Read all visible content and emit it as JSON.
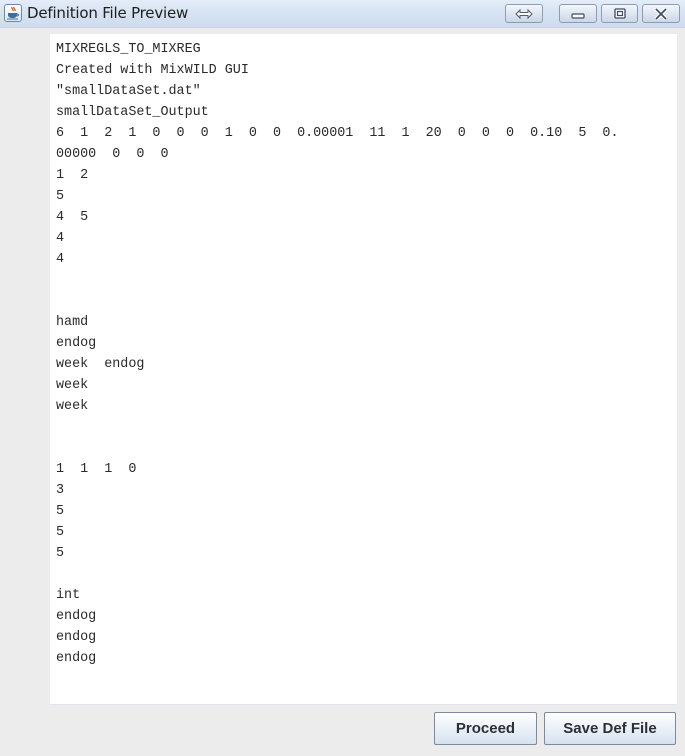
{
  "window": {
    "title": "Definition File Preview",
    "icon": "java-coffee-cup-icon",
    "controls": [
      {
        "name": "swap-button",
        "icon": "double-arrow-icon"
      },
      {
        "name": "minimize-button",
        "icon": "minimize-icon"
      },
      {
        "name": "maximize-button",
        "icon": "maximize-icon"
      },
      {
        "name": "close-button",
        "icon": "close-icon"
      }
    ]
  },
  "definition_file": {
    "lines": [
      "MIXREGLS_TO_MIXREG",
      "Created with MixWILD GUI",
      "\"smallDataSet.dat\"",
      "smallDataSet_Output",
      "6  1  2  1  0  0  0  1  0  0  0.00001  11  1  20  0  0  0  0.10  5  0.",
      "00000  0  0  0",
      "1  2",
      "5",
      "4  5",
      "4",
      "4",
      "",
      "",
      "hamd",
      "endog",
      "week  endog",
      "week",
      "week",
      "",
      "",
      "1  1  1  0",
      "3",
      "5",
      "5",
      "5",
      "",
      "int",
      "endog",
      "endog",
      "endog"
    ]
  },
  "buttons": {
    "proceed_label": "Proceed",
    "save_label": "Save Def File"
  }
}
